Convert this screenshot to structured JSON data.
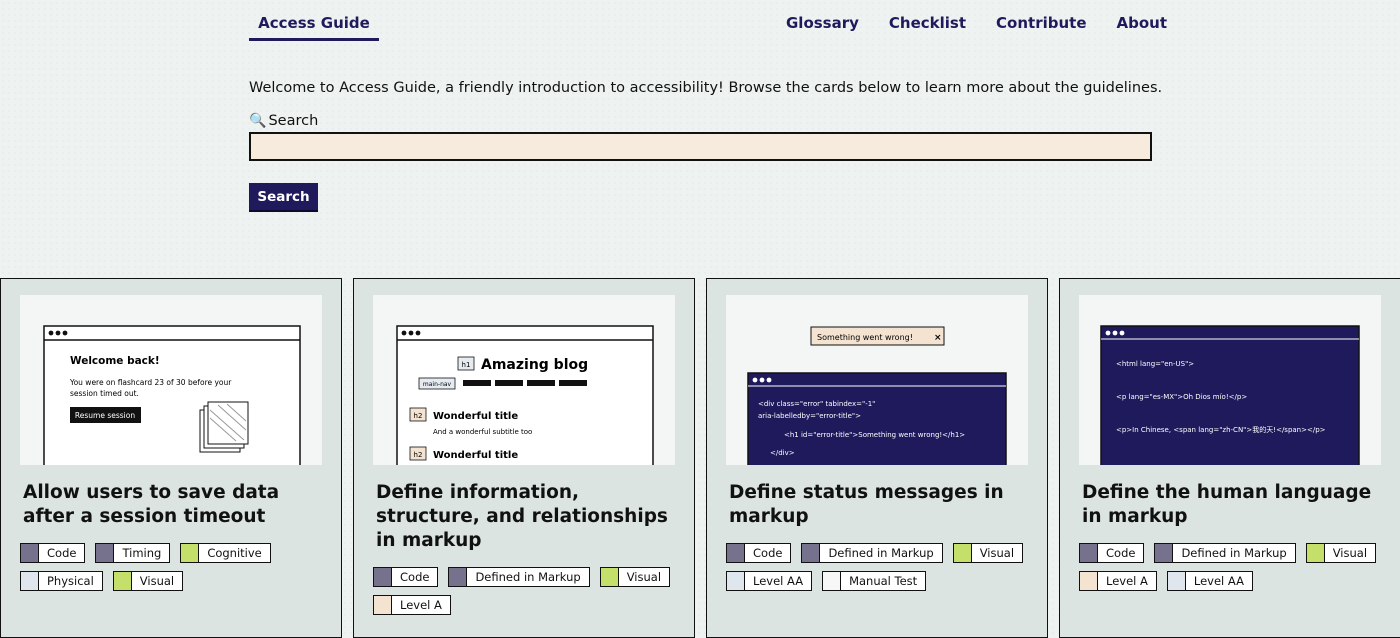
{
  "nav": {
    "brand": "Access Guide",
    "links": [
      "Glossary",
      "Checklist",
      "Contribute",
      "About"
    ]
  },
  "intro": {
    "welcome": "Welcome to Access Guide, a friendly introduction to accessibility! Browse the cards below to learn more about the guidelines.",
    "search_label": "Search",
    "search_value": "",
    "search_button": "Search"
  },
  "colors": {
    "brand": "#1f1a5c",
    "background": "#eef3f1",
    "card": "#dce4e1",
    "input": "#f6ebdc",
    "tag_purple": "#76718c",
    "tag_green": "#c4df6a"
  },
  "cards": [
    {
      "title": "Allow users to save data after a session timeout",
      "illustration": {
        "heading": "Welcome back!",
        "body_line1": "You were on flashcard 23 of 30 before your",
        "body_line2": "session timed out.",
        "button": "Resume session"
      },
      "tags": [
        {
          "label": "Code",
          "swatch": "purple"
        },
        {
          "label": "Timing",
          "swatch": "purple"
        },
        {
          "label": "Cognitive",
          "swatch": "green"
        },
        {
          "label": "Physical",
          "swatch": "blue"
        },
        {
          "label": "Visual",
          "swatch": "green"
        }
      ]
    },
    {
      "title": "Define information, structure, and relationships in markup",
      "illustration": {
        "h1_tag": "h1",
        "heading": "Amazing blog",
        "nav_tag": "main-nav",
        "h2_tag": "h2",
        "subheading": "Wonderful title",
        "subtitle": "And a wonderful subtitle too",
        "subheading2": "Wonderful title"
      },
      "tags": [
        {
          "label": "Code",
          "swatch": "purple"
        },
        {
          "label": "Defined in Markup",
          "swatch": "purple"
        },
        {
          "label": "Visual",
          "swatch": "green"
        },
        {
          "label": "Level A",
          "swatch": "peach"
        }
      ]
    },
    {
      "title": "Define status messages in markup",
      "illustration": {
        "toast": "Something went wrong!",
        "toast_close": "×",
        "code1": "<div class=\"error\" tabindex=\"-1\"",
        "code2": "aria-labelledby=\"error-title\">",
        "code3": "<h1 id=\"error-title\">Something went wrong!</h1>",
        "code4": "</div>"
      },
      "tags": [
        {
          "label": "Code",
          "swatch": "purple"
        },
        {
          "label": "Defined in Markup",
          "swatch": "purple"
        },
        {
          "label": "Visual",
          "swatch": "green"
        },
        {
          "label": "Level AA",
          "swatch": "blue"
        },
        {
          "label": "Manual Test",
          "swatch": "white"
        }
      ]
    },
    {
      "title": "Define the human language in markup",
      "illustration": {
        "code1": "<html lang=\"en-US\">",
        "code2": "<p lang=\"es-MX\">Oh Dios mío!</p>",
        "code3": "<p>In Chinese, <span lang=\"zh-CN\">我的天!</span></p>"
      },
      "tags": [
        {
          "label": "Code",
          "swatch": "purple"
        },
        {
          "label": "Defined in Markup",
          "swatch": "purple"
        },
        {
          "label": "Visual",
          "swatch": "green"
        },
        {
          "label": "Level A",
          "swatch": "peach"
        },
        {
          "label": "Level AA",
          "swatch": "blue"
        }
      ]
    }
  ]
}
